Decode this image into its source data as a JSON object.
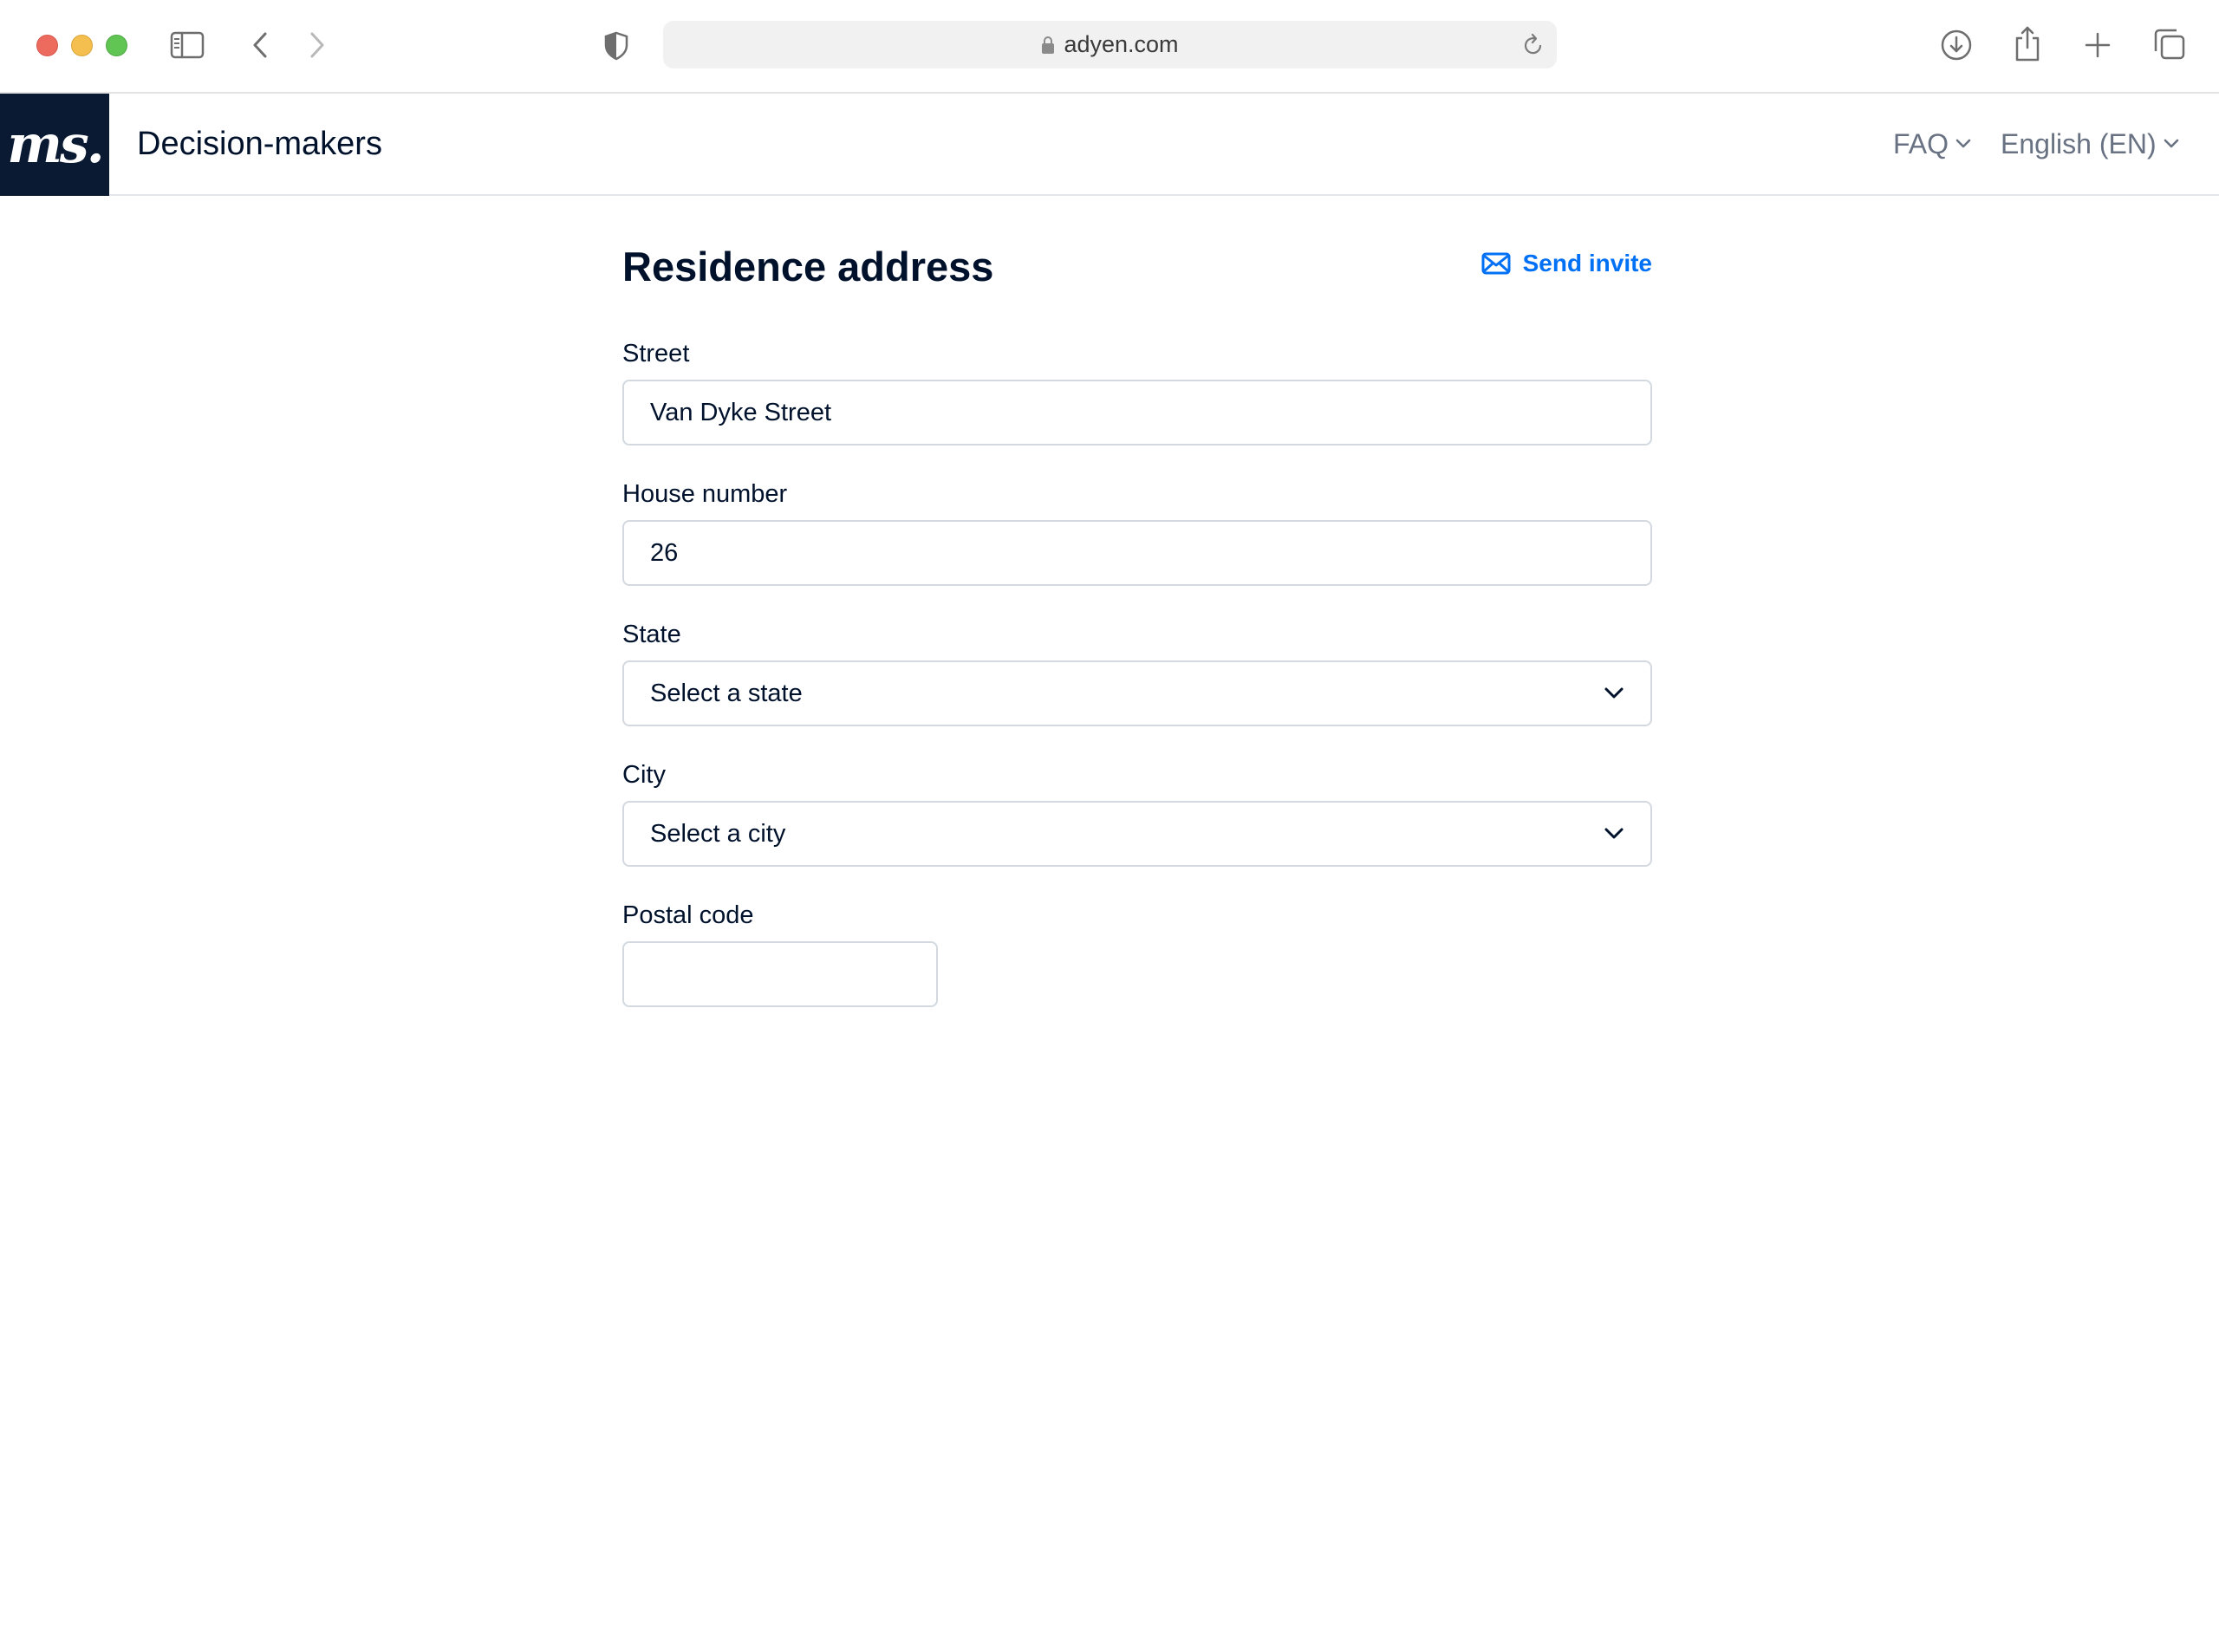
{
  "browser": {
    "url": "adyen.com"
  },
  "header": {
    "logo_text": "ms.",
    "title": "Decision-makers",
    "nav": {
      "faq_label": "FAQ",
      "language_label": "English (EN)"
    }
  },
  "form": {
    "heading": "Residence address",
    "send_invite_label": "Send invite",
    "fields": {
      "street": {
        "label": "Street",
        "value": "Van Dyke Street"
      },
      "house_number": {
        "label": "House number",
        "value": "26"
      },
      "state": {
        "label": "State",
        "value": "Select a state"
      },
      "city": {
        "label": "City",
        "value": "Select a city"
      },
      "postal_code": {
        "label": "Postal code",
        "value": ""
      }
    }
  },
  "colors": {
    "accent": "#0070f5",
    "logo_bg": "#0b1a33",
    "text": "#00112c",
    "muted": "#687282",
    "border": "#d4d9e0"
  },
  "icons": [
    "sidebar-icon",
    "back-icon",
    "forward-icon",
    "shield-icon",
    "lock-icon",
    "reload-icon",
    "download-icon",
    "share-icon",
    "new-tab-icon",
    "tabs-icon",
    "mail-icon",
    "chevron-down-icon"
  ]
}
